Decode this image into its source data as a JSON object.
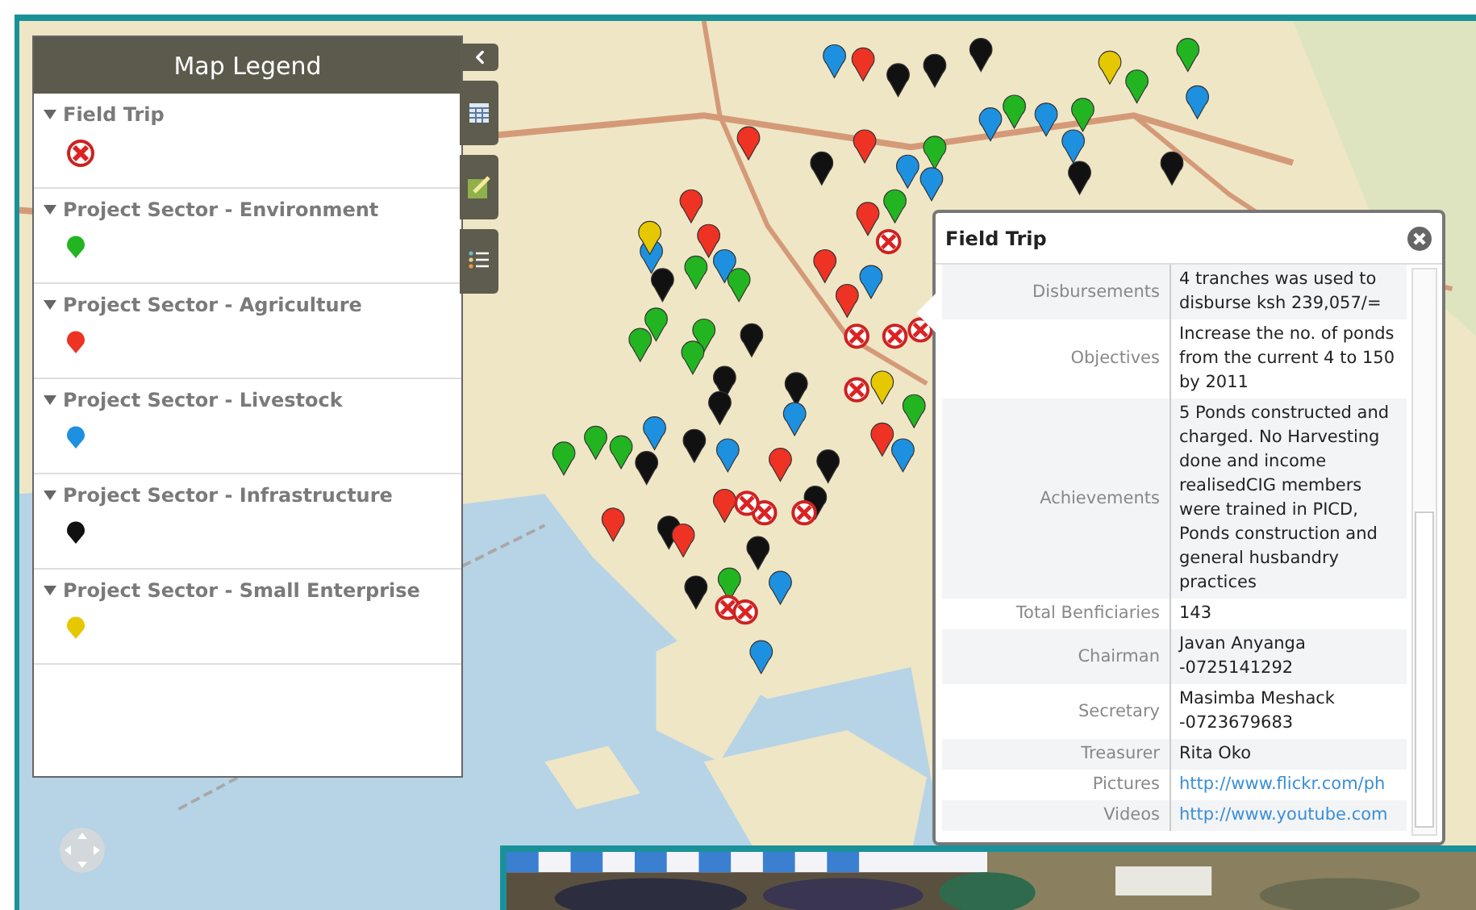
{
  "legend": {
    "title": "Map Legend",
    "sections": [
      {
        "label": "Field Trip",
        "expanded": true,
        "kind": "badge"
      },
      {
        "label": "Project Sector - Environment",
        "expanded": true,
        "kind": "pin",
        "color": "#22b521"
      },
      {
        "label": "Project Sector - Agriculture",
        "expanded": true,
        "kind": "pin",
        "color": "#ee3224"
      },
      {
        "label": "Project Sector - Livestock",
        "expanded": true,
        "kind": "pin",
        "color": "#1e90e0"
      },
      {
        "label": "Project Sector - Infrastructure",
        "expanded": true,
        "kind": "pin",
        "color": "#111111"
      },
      {
        "label": "Project Sector - Small Enterprise",
        "expanded": true,
        "kind": "pin",
        "color": "#e6c800"
      }
    ]
  },
  "popup": {
    "title": "Field Trip",
    "rows": [
      {
        "label": "Disbursements",
        "value": "4 tranches was used to disburse ksh 239,057/=",
        "kind": "text"
      },
      {
        "label": "Objectives",
        "value": "Increase the no. of ponds from the current 4 to 150 by 2011",
        "kind": "text"
      },
      {
        "label": "Achievements",
        "value": "5 Ponds constructed and charged. No Harvesting done and income realisedCIG members were trained in PICD, Ponds construction and general husbandry practices",
        "kind": "text"
      },
      {
        "label": "Total Benficiaries",
        "value": "143",
        "kind": "text"
      },
      {
        "label": "Chairman",
        "value": "Javan Anyanga -0725141292",
        "kind": "text"
      },
      {
        "label": "Secretary",
        "value": "Masimba Meshack -0723679683",
        "kind": "text"
      },
      {
        "label": "Treasurer",
        "value": "Rita Oko",
        "kind": "text"
      },
      {
        "label": "Pictures",
        "value": "http://www.flickr.com/ph",
        "kind": "link"
      },
      {
        "label": "Videos",
        "value": "http://www.youtube.com",
        "kind": "link"
      }
    ]
  }
}
